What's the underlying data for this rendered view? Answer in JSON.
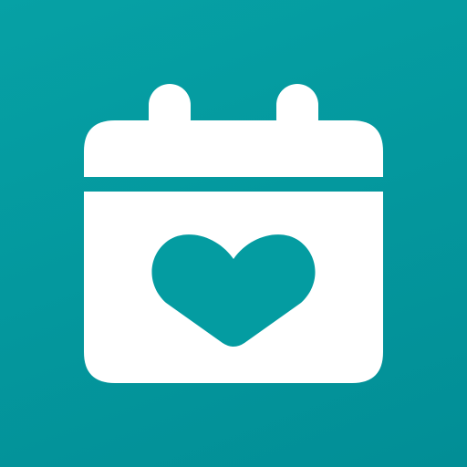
{
  "icon": {
    "name": "calendar-heart-icon",
    "background_top": "#06a1a5",
    "background_bottom": "#028e96",
    "glyph_color": "#ffffff",
    "heart_color": "#049ca1"
  }
}
